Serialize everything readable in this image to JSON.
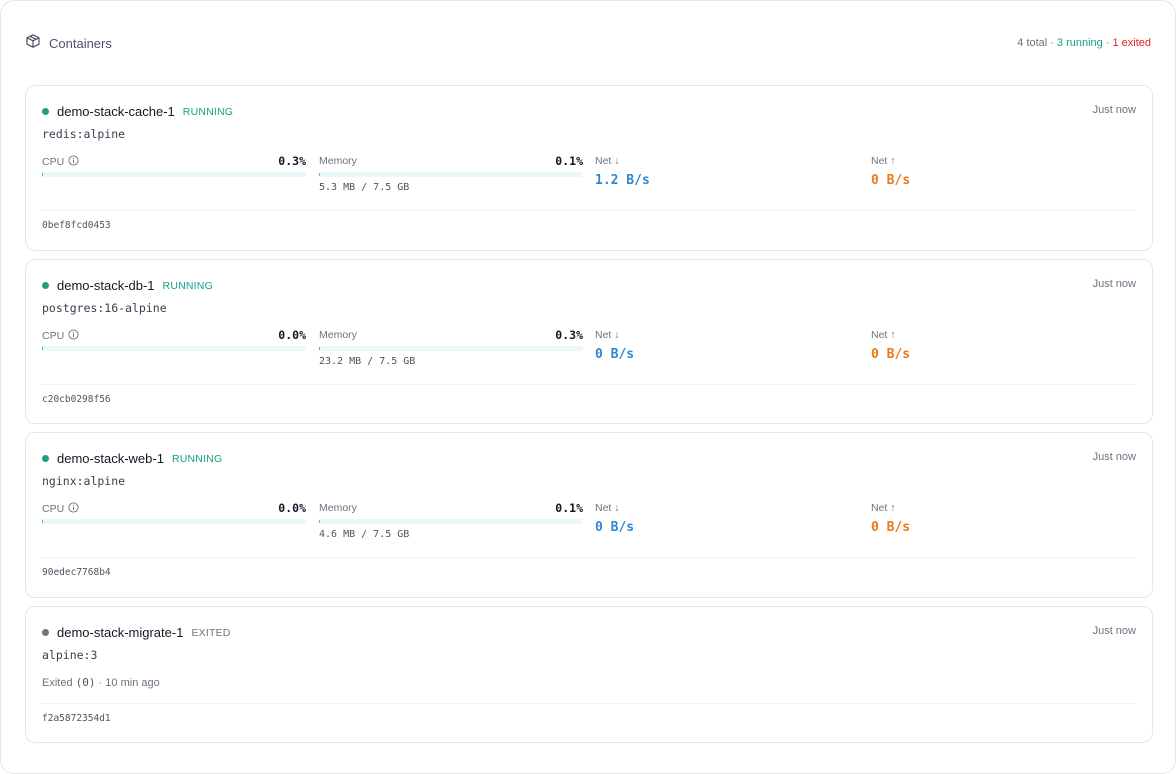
{
  "header": {
    "title": "Containers",
    "icon": "box-icon",
    "summary": {
      "total": "4 total",
      "sep1": "·",
      "running": "3 running",
      "sep2": "·",
      "exited": "1 exited"
    }
  },
  "colors": {
    "running": "#14a085",
    "exited": "#dc2626",
    "net_down": "#2f86d8",
    "net_up": "#ea7a16",
    "bar_fill": "#22c55e"
  },
  "containers": [
    {
      "name": "demo-stack-cache-1",
      "status": "RUNNING",
      "time": "Just now",
      "image": "redis:alpine",
      "cpu": {
        "label": "CPU",
        "pct": "0.3%",
        "fill": 0.3
      },
      "memory": {
        "label": "Memory",
        "pct": "0.1%",
        "fill": 0.1,
        "usage": "5.3 MB / 7.5 GB"
      },
      "net_down": {
        "label": "Net ↓",
        "value": "1.2 B/s"
      },
      "net_up": {
        "label": "Net ↑",
        "value": "0 B/s"
      },
      "id": "0bef8fcd0453"
    },
    {
      "name": "demo-stack-db-1",
      "status": "RUNNING",
      "time": "Just now",
      "image": "postgres:16-alpine",
      "cpu": {
        "label": "CPU",
        "pct": "0.0%",
        "fill": 0.0
      },
      "memory": {
        "label": "Memory",
        "pct": "0.3%",
        "fill": 0.3,
        "usage": "23.2 MB / 7.5 GB"
      },
      "net_down": {
        "label": "Net ↓",
        "value": "0 B/s"
      },
      "net_up": {
        "label": "Net ↑",
        "value": "0 B/s"
      },
      "id": "c20cb0298f56"
    },
    {
      "name": "demo-stack-web-1",
      "status": "RUNNING",
      "time": "Just now",
      "image": "nginx:alpine",
      "cpu": {
        "label": "CPU",
        "pct": "0.0%",
        "fill": 0.0
      },
      "memory": {
        "label": "Memory",
        "pct": "0.1%",
        "fill": 0.1,
        "usage": "4.6 MB / 7.5 GB"
      },
      "net_down": {
        "label": "Net ↓",
        "value": "0 B/s"
      },
      "net_up": {
        "label": "Net ↑",
        "value": "0 B/s"
      },
      "id": "90edec7768b4"
    },
    {
      "name": "demo-stack-migrate-1",
      "status": "EXITED",
      "time": "Just now",
      "image": "alpine:3",
      "exit": {
        "prefix": "Exited",
        "code": "(0)",
        "suffix": "· 10 min ago"
      },
      "id": "f2a5872354d1"
    }
  ]
}
